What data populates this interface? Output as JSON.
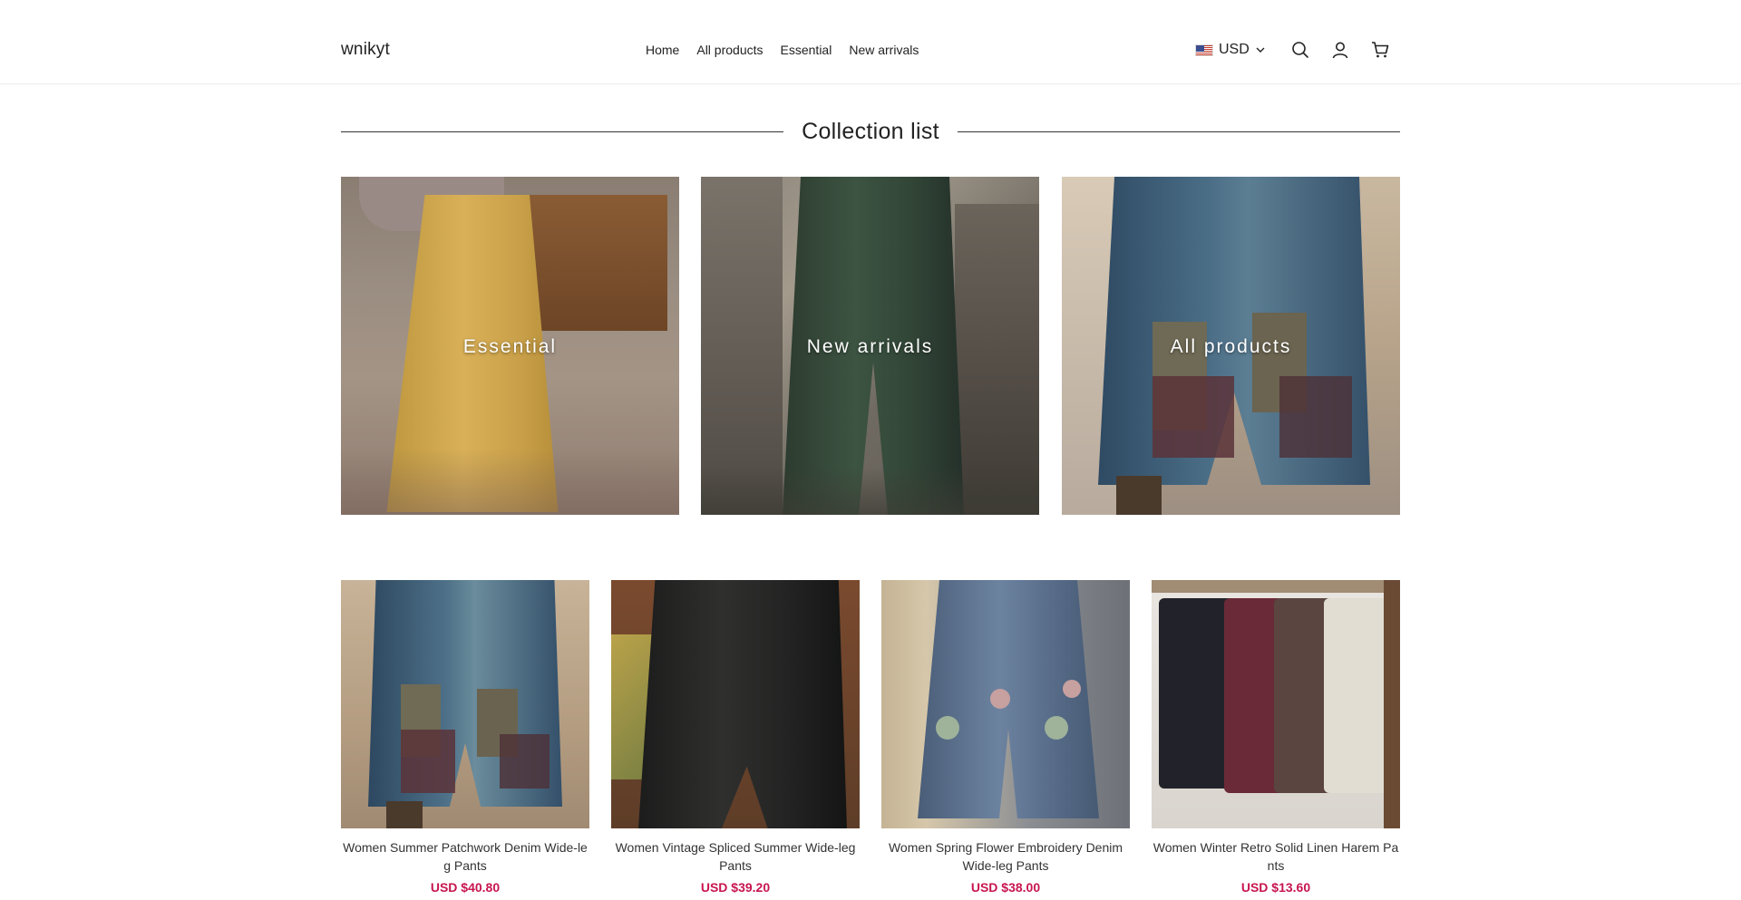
{
  "header": {
    "logo": "wnikyt",
    "nav": [
      "Home",
      "All products",
      "Essential",
      "New arrivals"
    ],
    "currency": "USD"
  },
  "section": {
    "title": "Collection list"
  },
  "collections": [
    {
      "label": "Essential"
    },
    {
      "label": "New arrivals"
    },
    {
      "label": "All products"
    }
  ],
  "products": [
    {
      "name": "Women Summer Patchwork Denim Wide-leg Pants",
      "price": "USD $40.80"
    },
    {
      "name": "Women Vintage Spliced Summer Wide-leg Pants",
      "price": "USD $39.20"
    },
    {
      "name": "Women Spring Flower Embroidery Denim Wide-leg Pants",
      "price": "USD $38.00"
    },
    {
      "name": "Women Winter Retro Solid Linen Harem Pants",
      "price": "USD $13.60"
    }
  ],
  "colors": {
    "price": "#c7154f",
    "text": "#222222"
  }
}
